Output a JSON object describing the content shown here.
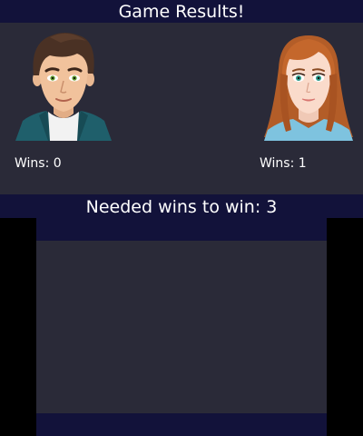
{
  "header": {
    "title": "Game Results!"
  },
  "players": [
    {
      "wins_label": "Wins: 0",
      "avatar": "male-player-avatar"
    },
    {
      "wins_label": "Wins: 1",
      "avatar": "female-player-avatar"
    }
  ],
  "needed": {
    "label": "Needed wins to win: 3"
  },
  "colors": {
    "panel_background": "#2a2a38",
    "bar_background": "#12123a",
    "text": "#ffffff",
    "letterbox": "#000000"
  }
}
